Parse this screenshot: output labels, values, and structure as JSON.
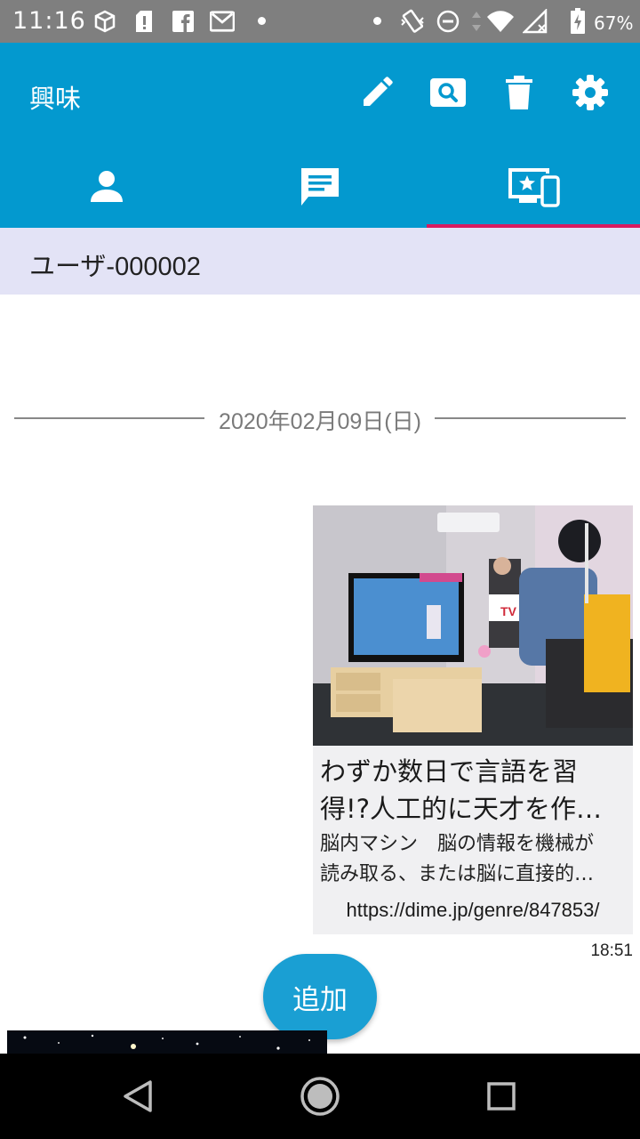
{
  "status_bar": {
    "time": "11:16",
    "battery_percent": "67%",
    "icons": [
      "cube-icon",
      "sd-card-alert-icon",
      "facebook-icon",
      "gmail-icon",
      "notification-dot-icon",
      "vibrate-icon",
      "do-not-disturb-icon",
      "data-arrows-icon",
      "wifi-icon",
      "no-signal-icon",
      "battery-charging-icon"
    ]
  },
  "app_bar": {
    "title": "興味",
    "actions": [
      "edit-icon",
      "search-icon",
      "delete-icon",
      "settings-icon"
    ],
    "tabs": [
      "person-icon",
      "chat-icon",
      "devices-star-icon"
    ],
    "selected_tab": 2,
    "color": "#0399cf",
    "indicator_color": "#d81b60"
  },
  "user": {
    "name": "ユーザ-000002"
  },
  "timeline": {
    "date": "2020年02月09日(日)",
    "card": {
      "title_line1": "わずか数日で言語を習",
      "title_line2": "得!?人工的に天才を作り…",
      "desc_line1": "脳内マシン　脳の情報を機械が",
      "desc_line2": "読み取る、または脳に直接的…",
      "url": "https://dime.jp/genre/847853/",
      "time": "18:51",
      "image_sign": "TV"
    }
  },
  "add_button": {
    "label": "追加",
    "color": "#1a9fd3"
  },
  "nav_bar": {
    "buttons": [
      "back-icon",
      "home-icon",
      "recents-icon"
    ]
  }
}
